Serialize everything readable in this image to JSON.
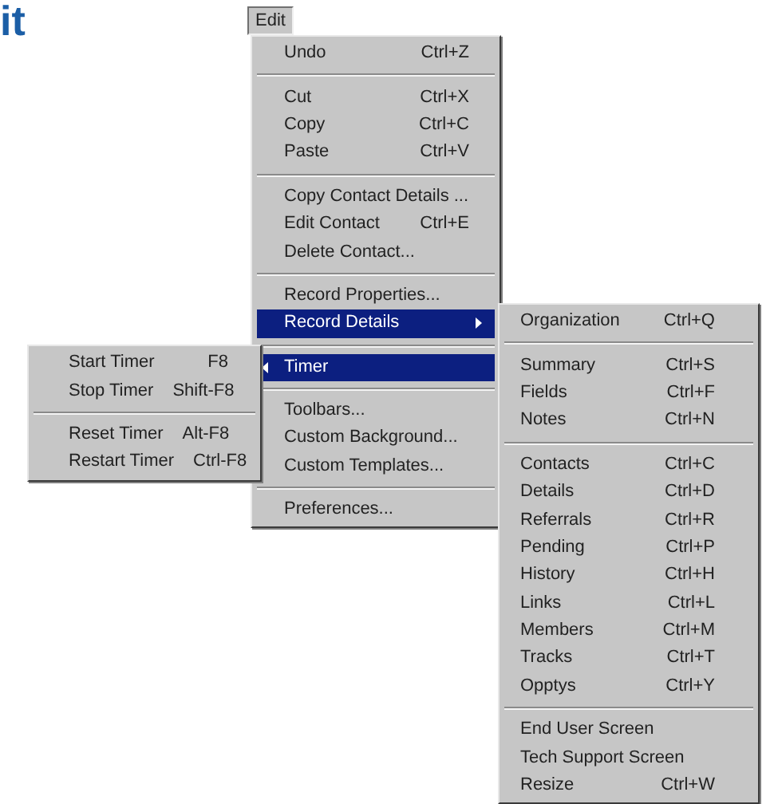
{
  "heading": "it",
  "menu_bar": [
    {
      "label": "Edit",
      "selected": true
    }
  ],
  "edit_menu": {
    "items": [
      {
        "kind": "item",
        "label": "Undo",
        "shortcut": "Ctrl+Z",
        "selected": false
      },
      {
        "kind": "separator"
      },
      {
        "kind": "item",
        "label": "Cut",
        "shortcut": "Ctrl+X",
        "selected": false
      },
      {
        "kind": "item",
        "label": "Copy",
        "shortcut": "Ctrl+C",
        "selected": false
      },
      {
        "kind": "item",
        "label": "Paste",
        "shortcut": "Ctrl+V",
        "selected": false
      },
      {
        "kind": "separator"
      },
      {
        "kind": "item",
        "label": "Copy Contact Details ...",
        "selected": false
      },
      {
        "kind": "item",
        "label": "Edit Contact",
        "shortcut": "Ctrl+E",
        "selected": false
      },
      {
        "kind": "item",
        "label": "Delete Contact...",
        "selected": false
      },
      {
        "kind": "separator"
      },
      {
        "kind": "item",
        "label": "Record Properties...",
        "selected": false
      },
      {
        "kind": "submenu_right",
        "label": "Record Details",
        "selected": true
      },
      {
        "kind": "separator"
      },
      {
        "kind": "submenu_left",
        "label": "Timer",
        "selected": true
      },
      {
        "kind": "separator"
      },
      {
        "kind": "item",
        "label": "Toolbars...",
        "selected": false
      },
      {
        "kind": "item",
        "label": "Custom Background...",
        "selected": false
      },
      {
        "kind": "item",
        "label": "Custom Templates...",
        "selected": false
      },
      {
        "kind": "separator"
      },
      {
        "kind": "item",
        "label": "Preferences...",
        "selected": false
      }
    ]
  },
  "timer_submenu": {
    "items": [
      {
        "kind": "item",
        "label": "Start Timer",
        "shortcut": "F8",
        "selected": false
      },
      {
        "kind": "item",
        "label": "Stop Timer",
        "shortcut": "Shift-F8",
        "selected": false
      },
      {
        "kind": "separator"
      },
      {
        "kind": "item",
        "label": "Reset Timer",
        "shortcut": "Alt-F8",
        "selected": false
      },
      {
        "kind": "item",
        "label": "Restart Timer",
        "shortcut": "Ctrl-F8",
        "selected": false
      }
    ]
  },
  "record_details_submenu": {
    "items": [
      {
        "kind": "item",
        "label": "Organization",
        "shortcut": "Ctrl+Q",
        "selected": false
      },
      {
        "kind": "separator"
      },
      {
        "kind": "item",
        "label": "Summary",
        "shortcut": "Ctrl+S",
        "selected": false
      },
      {
        "kind": "item",
        "label": "Fields",
        "shortcut": "Ctrl+F",
        "selected": false
      },
      {
        "kind": "item",
        "label": "Notes",
        "shortcut": "Ctrl+N",
        "selected": false
      },
      {
        "kind": "separator"
      },
      {
        "kind": "item",
        "label": "Contacts",
        "shortcut": "Ctrl+C",
        "selected": false
      },
      {
        "kind": "item",
        "label": "Details",
        "shortcut": "Ctrl+D",
        "selected": false
      },
      {
        "kind": "item",
        "label": "Referrals",
        "shortcut": "Ctrl+R",
        "selected": false
      },
      {
        "kind": "item",
        "label": "Pending",
        "shortcut": "Ctrl+P",
        "selected": false
      },
      {
        "kind": "item",
        "label": "History",
        "shortcut": "Ctrl+H",
        "selected": false
      },
      {
        "kind": "item",
        "label": "Links",
        "shortcut": "Ctrl+L",
        "selected": false
      },
      {
        "kind": "item",
        "label": "Members",
        "shortcut": "Ctrl+M",
        "selected": false
      },
      {
        "kind": "item",
        "label": "Tracks",
        "shortcut": "Ctrl+T",
        "selected": false
      },
      {
        "kind": "item",
        "label": "Opptys",
        "shortcut": "Ctrl+Y",
        "selected": false
      },
      {
        "kind": "separator"
      },
      {
        "kind": "item",
        "label": "End User Screen",
        "selected": false
      },
      {
        "kind": "item",
        "label": "Tech Support Screen",
        "selected": false
      },
      {
        "kind": "item",
        "label": "Resize",
        "shortcut": "Ctrl+W",
        "selected": false
      }
    ]
  }
}
